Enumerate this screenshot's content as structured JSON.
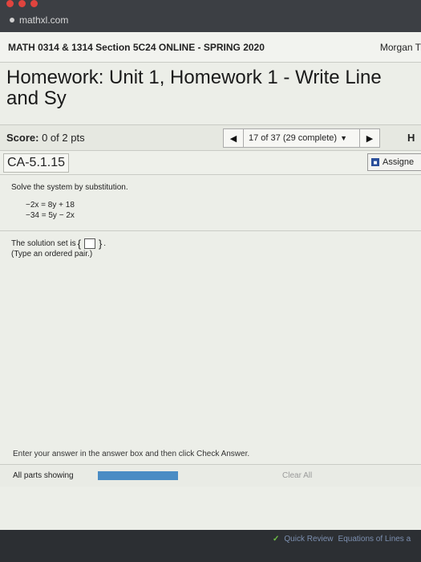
{
  "browser": {
    "url": "mathxl.com",
    "dots": [
      "#e0443e",
      "#e0443e",
      "#e0443e"
    ]
  },
  "course_bar": {
    "course_title": "MATH 0314 & 1314 Section 5C24 ONLINE - SPRING 2020",
    "user_name": "Morgan T"
  },
  "homework_title": "Homework: Unit 1, Homework 1 - Write Line and Sy",
  "score": {
    "label": "Score:",
    "value": "0 of 2 pts"
  },
  "navigator": {
    "prev": "◀",
    "position": "17 of 37 (29 complete)",
    "next": "▶"
  },
  "help_letter": "H",
  "question": {
    "id": "CA-5.1.15",
    "assign_label": "Assigne",
    "instruction": "Solve the system by substitution.",
    "equations": [
      "−2x  = 8y + 18",
      "−34 = 5y − 2x"
    ],
    "answer_prefix": "The solution set is",
    "answer_suffix": ".",
    "answer_hint": "(Type an ordered pair.)"
  },
  "footer": {
    "enter_msg": "Enter your answer in the answer box and then click Check Answer.",
    "parts_label": "All parts showing",
    "clear_all": "Clear All",
    "quick_review": "Quick Review",
    "equations_link": "Equations of Lines a"
  },
  "colors": {
    "progress": "#4a8cc4",
    "assign_icon": "#2b4f9a"
  }
}
